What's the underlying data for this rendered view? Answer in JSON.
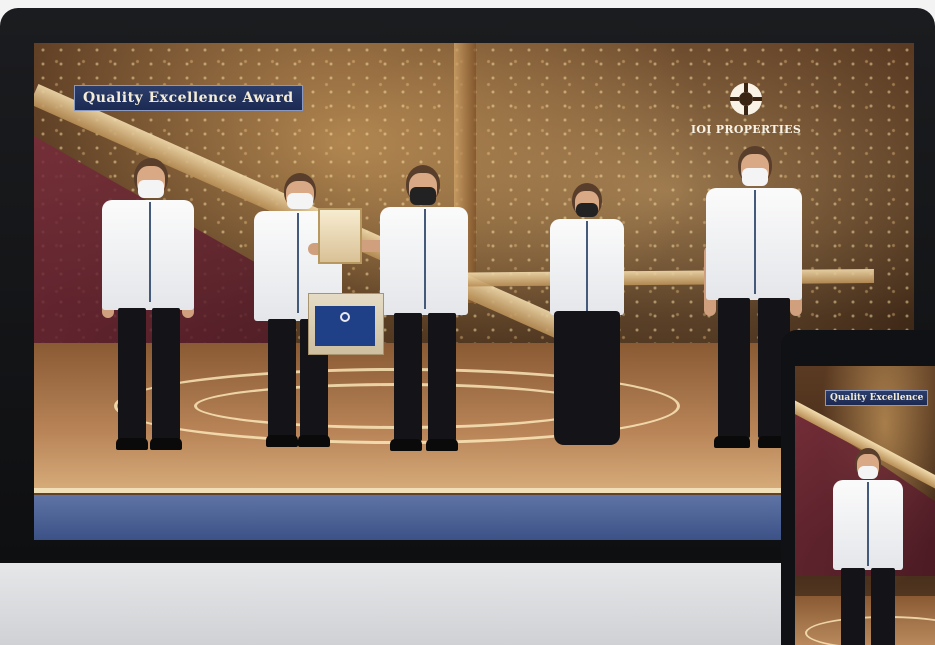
{
  "banner": {
    "title": "Quality Excellence Award"
  },
  "logo": {
    "name": "IOI PROPERTIES",
    "icon": "ioi-logo-icon"
  },
  "tablet": {
    "banner_title": "Quality Excellence"
  },
  "colors": {
    "banner_bg": "#1c2a52",
    "banner_text": "#f4ecd6",
    "bezel": "#0e0f11",
    "stage_gold": "#b88e55",
    "stage_blue": "#3c5287"
  }
}
